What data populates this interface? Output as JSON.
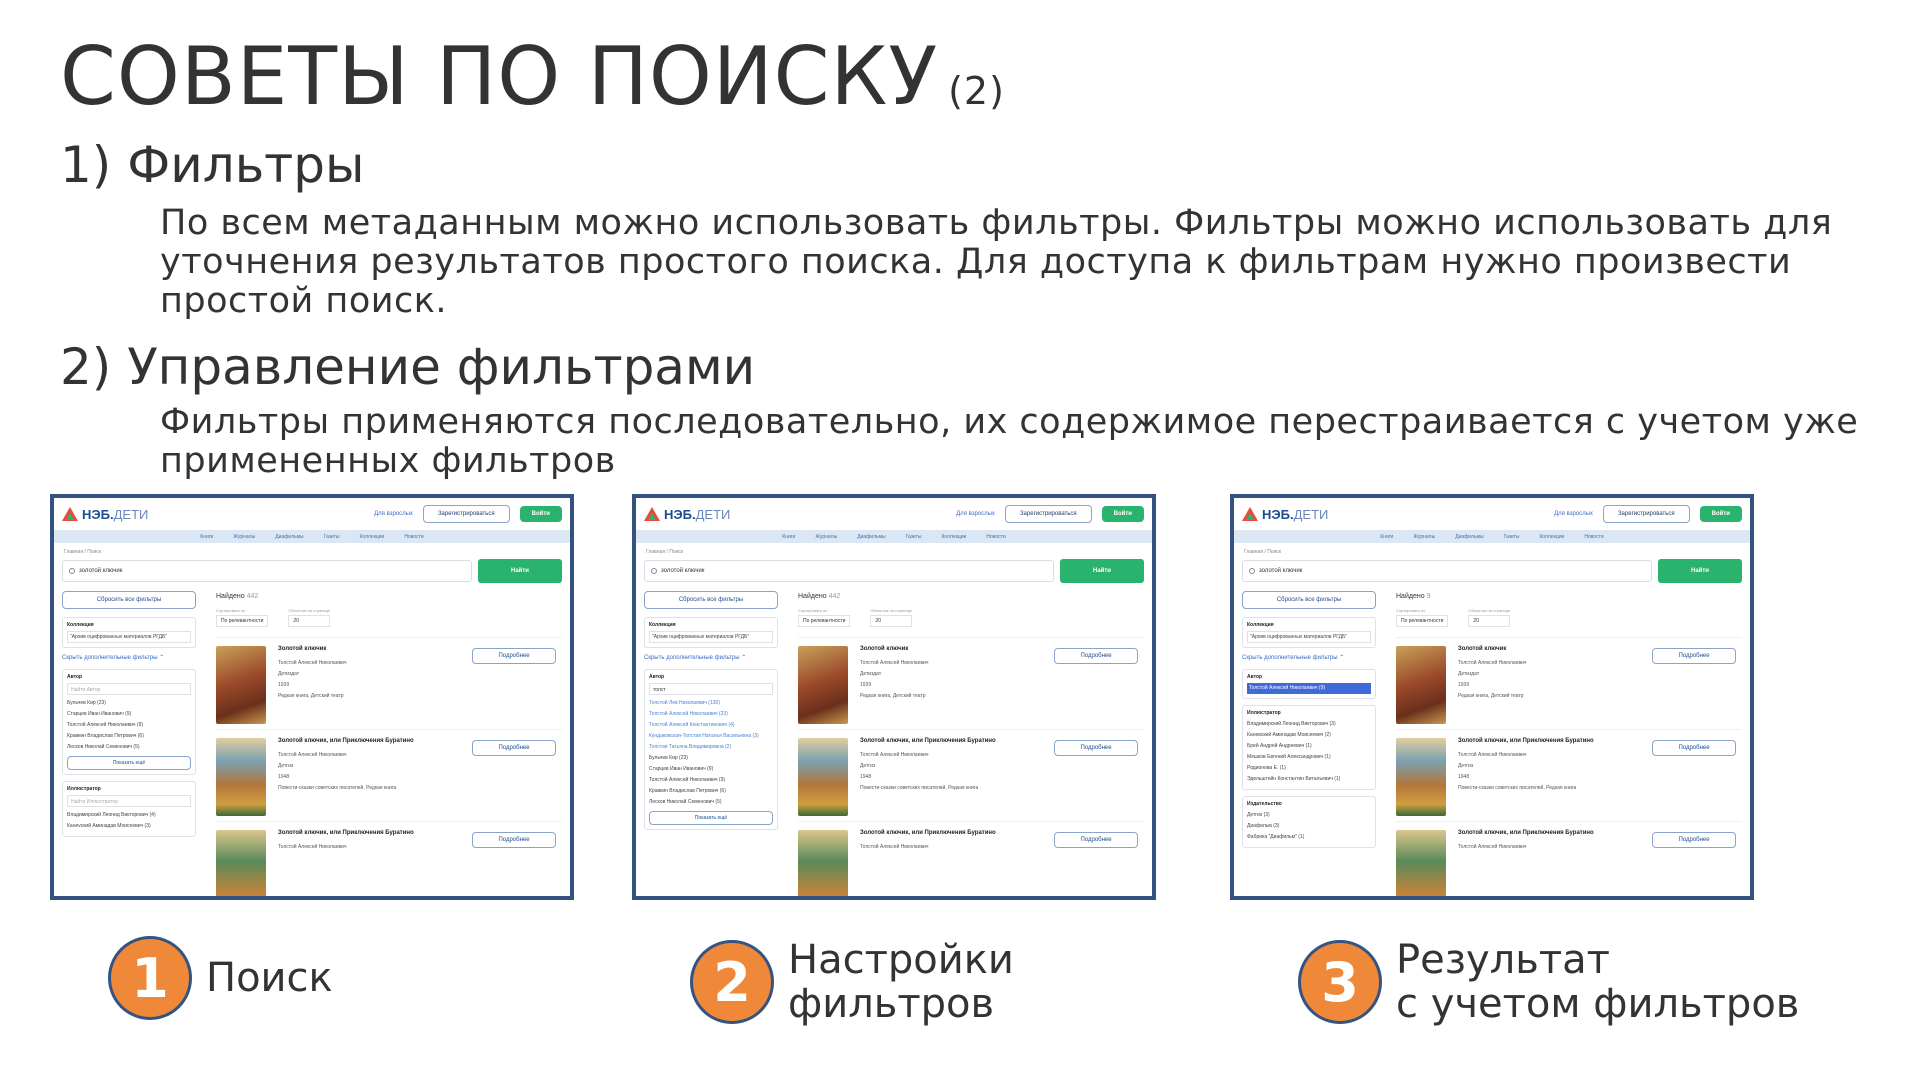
{
  "slide": {
    "title": "СОВЕТЫ ПО ПОИСКУ",
    "title_suffix": "(2)",
    "section1": {
      "heading": "1) Фильтры",
      "text": "По всем метаданным можно использовать фильтры. Фильтры можно использовать для уточнения результатов простого поиска. Для доступа к фильтрам нужно произвести простой поиск."
    },
    "section2": {
      "heading": "2) Управление фильтрами",
      "text": "Фильтры применяются последовательно, их содержимое перестраивается с учетом уже примененных фильтров"
    },
    "steps": [
      {
        "number": "1",
        "line1": "Поиск",
        "line2": ""
      },
      {
        "number": "2",
        "line1": "Настройки",
        "line2": "фильтров"
      },
      {
        "number": "3",
        "line1": "Результат",
        "line2": "с учетом фильтров"
      }
    ]
  },
  "shot_common": {
    "logo_bold": "НЭБ.",
    "logo_light": "ДЕТИ",
    "for_parents": "Для взрослых",
    "register": "Зарегистрироваться",
    "login": "Войти",
    "nav": [
      "Книги",
      "Журналы",
      "Диафильмы",
      "Газеты",
      "Коллекции",
      "Новости"
    ],
    "breadcrumbs": "Главная / Поиск",
    "query": "золотой ключик",
    "find": "Найти",
    "reset_filters": "Сбросить все фильтры",
    "collection_title": "Коллекция",
    "collection_value": "\"Архив оцифрованных материалов РГДБ\"",
    "hide_more": "Скрыть дополнительные фильтры ⌃",
    "author_title": "Автор",
    "author_placeholder": "Найти Автор",
    "illustrator_title": "Иллюстратор",
    "illustrator_placeholder": "Найти Иллюстратор",
    "publisher_title": "Издательство",
    "show_more": "Показать ещё",
    "found_label": "Найдено",
    "sort_label": "Сортировать по",
    "sort_value": "По релевантности",
    "per_page_label": "Объектов на странице",
    "per_page_value": "20",
    "details": "Подробнее"
  },
  "shot1": {
    "found_count": "442",
    "authors": [
      "Бульчев Кир (23)",
      "Старцев Иван Иванович (9)",
      "Толстой Алексей Николаевич (9)",
      "Кравкин Владислав Петрович (6)",
      "Лесков Николай Семенович (5)"
    ],
    "illustrators": [
      "Владимирский Леонид Викторович (4)",
      "Канevский Аминадав Моисеевич (3)"
    ]
  },
  "shot2": {
    "found_count": "442",
    "author_query": "толст",
    "author_matches": [
      "Толстой Лев Николаевич (130)",
      "Толстой Алексей Николаевич (23)",
      "Толстой Алексей Константинович (4)",
      "Кундаковская-Толстая Наталья Васильевна (3)",
      "Толстая Татьяна Владимировна (2)"
    ],
    "authors": [
      "Бульчев Кир (23)",
      "Старцев Иван Иванович (9)",
      "Толстой Алексей Николаевич (9)",
      "Кравкин Владислав Петрович (6)",
      "Лесков Николай Семенович (5)"
    ]
  },
  "shot3": {
    "found_count": "9",
    "selected_author": "Толстой Алексей Николаевич (9)",
    "illustrators": [
      "Владимирский Леонид Викторович (3)",
      "Каневский Аминадав Моисеевич (2)",
      "Брей Андрей Андреевич (1)",
      "Мешков Евгений Александрович (1)",
      "Родионова Е. (1)",
      "Эдельштейн Константин Витальевич (1)"
    ],
    "publishers": [
      "Детгиз (3)",
      "Диафильм (3)",
      "Фабрика \"Диафильм\" (1)"
    ]
  },
  "books": [
    {
      "title": "Золотой ключик",
      "author": "Толстой Алексей Николаевич",
      "publisher": "Детиздат",
      "year": "1939",
      "meta": "Редкая книга, Детский театр"
    },
    {
      "title": "Золотой ключик, или Приключения Буратино",
      "author": "Толстой Алексей Николаевич",
      "publisher": "Детгиз",
      "year": "1948",
      "meta": "Повести-сказки советских писателей, Редкая книга"
    },
    {
      "title": "Золотой ключик, или Приключения Буратино",
      "author": "Толстой Алексей Николаевич",
      "publisher": "",
      "year": "",
      "meta": ""
    }
  ],
  "colors": {
    "accent_orange": "#f0883a",
    "frame_blue": "#33527e",
    "green": "#29b36c"
  }
}
